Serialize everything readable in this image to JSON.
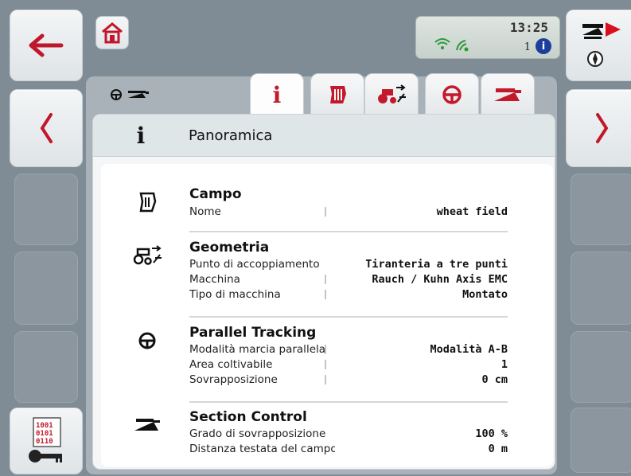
{
  "status_bar": {
    "time": "13:25",
    "notification_count": "1",
    "info_symbol": "i",
    "icons": [
      "wifi-icon",
      "gps-signal-icon",
      "info-icon"
    ]
  },
  "nav": {
    "back_icon": "arrow-left-icon",
    "home_icon": "home-icon",
    "prev_icon": "chevron-left-icon",
    "next_icon": "chevron-right-icon",
    "implement_icon": "implement-compass-icon",
    "license_icon": "license-key-icon"
  },
  "breadcrumb_icons": [
    "steering-icon",
    "implement-icon"
  ],
  "tabs": [
    {
      "icon": "info-icon",
      "symbol": "i",
      "active": true
    },
    {
      "icon": "field-icon",
      "active": false
    },
    {
      "icon": "tractor-geometry-icon",
      "active": false
    },
    {
      "icon": "steering-wheel-icon",
      "active": false
    },
    {
      "icon": "section-control-icon",
      "active": false
    }
  ],
  "header": {
    "icon_symbol": "i",
    "title": "Panoramica"
  },
  "sections": [
    {
      "title": "Campo",
      "icon": "field-icon",
      "rows": [
        {
          "label": "Nome",
          "value": "wheat field"
        }
      ]
    },
    {
      "title": "Geometria",
      "icon": "tractor-geometry-icon",
      "rows": [
        {
          "label": "Punto di accoppiamento",
          "value": "Tiranteria a tre punti"
        },
        {
          "label": "Macchina",
          "value": "Rauch / Kuhn Axis EMC"
        },
        {
          "label": "Tipo di macchina",
          "value": "Montato"
        }
      ]
    },
    {
      "title": "Parallel Tracking",
      "icon": "steering-wheel-icon",
      "rows": [
        {
          "label": "Modalità marcia parallela",
          "value": "Modalità A-B"
        },
        {
          "label": "Area coltivabile",
          "value": "1"
        },
        {
          "label": "Sovrapposizione",
          "value": "0 cm"
        }
      ]
    },
    {
      "title": "Section Control",
      "icon": "section-control-icon",
      "rows": [
        {
          "label": "Grado di sovrapposizione",
          "value": "100 %"
        },
        {
          "label": "Distanza testata del campo",
          "value": "0 m"
        }
      ]
    }
  ],
  "colors": {
    "back_arrow": "#c0182a",
    "implement_arrow": "#d8101e",
    "tab_icon_red": "#c4192b",
    "info_badge": "#1e3e9b",
    "wifi_green": "#2a9a3a"
  }
}
